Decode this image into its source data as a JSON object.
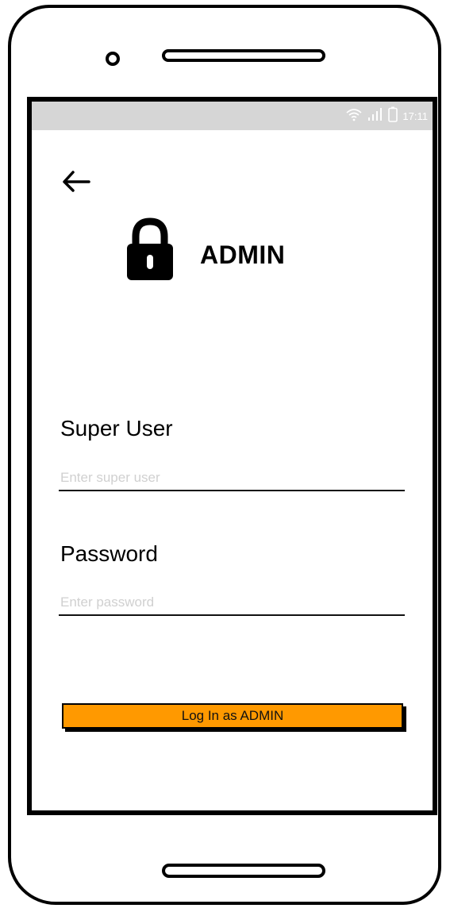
{
  "status_bar": {
    "time": "17:11",
    "icons": [
      "wifi-icon",
      "signal-icon",
      "battery-icon"
    ]
  },
  "header": {
    "back_icon": "back-arrow-icon",
    "lock_icon": "lock-icon",
    "title": "ADMIN"
  },
  "form": {
    "user_label": "Super User",
    "user_placeholder": "Enter super user",
    "user_value": "",
    "password_label": "Password",
    "password_placeholder": "Enter password",
    "password_value": ""
  },
  "actions": {
    "login_label": "Log In as ADMIN"
  },
  "colors": {
    "accent": "#ff9900",
    "status_bar": "#d6d6d6",
    "placeholder": "#d0d0d0"
  }
}
